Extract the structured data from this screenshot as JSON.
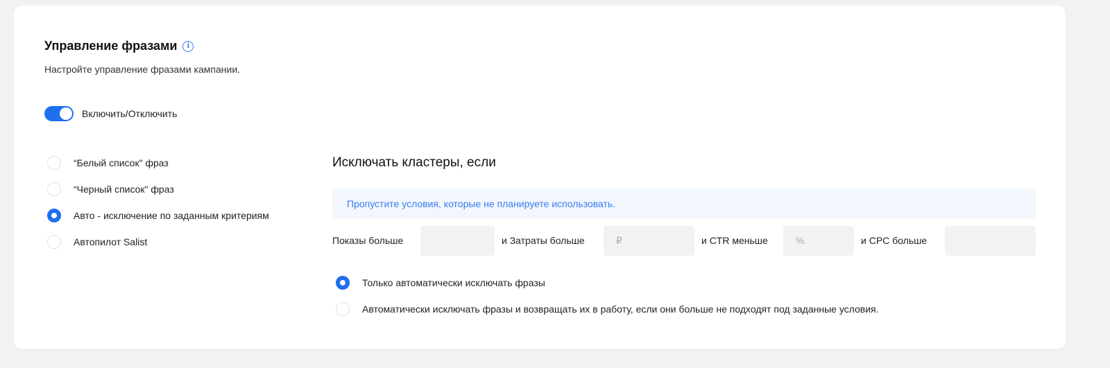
{
  "header": {
    "title": "Управление фразами",
    "info_glyph": "i",
    "subtitle": "Настройте управление фразами кампании."
  },
  "toggle": {
    "label": "Включить/Отключить",
    "enabled": true
  },
  "phrase_modes": [
    {
      "label": "“Белый список\" фраз",
      "checked": false
    },
    {
      "label": "“Черный список\" фраз",
      "checked": false
    },
    {
      "label": "Авто - исключение по заданным критериям",
      "checked": true
    },
    {
      "label": "Автопилот Salist",
      "checked": false
    }
  ],
  "exclusion": {
    "title": "Исключать кластеры, если",
    "hint": "Пропустите условия, которые не планируете использовать.",
    "criteria": {
      "impressions_label": "Показы больше",
      "impressions_placeholder": "",
      "cost_label": "и Затраты больше",
      "cost_placeholder": "₽",
      "ctr_label": "и CTR меньше",
      "ctr_placeholder": "%",
      "cpc_label": "и CPC больше",
      "cpc_placeholder": ""
    },
    "options": [
      {
        "label": "Только автоматически исключать фразы",
        "checked": true
      },
      {
        "label": "Автоматически исключать фразы и возвращать их в работу, если они больше не подходят под заданные условия.",
        "checked": false
      }
    ]
  },
  "colors": {
    "accent": "#1f6fef",
    "hint_bg": "#f2f7fd",
    "hint_text": "#3a7bf2"
  }
}
